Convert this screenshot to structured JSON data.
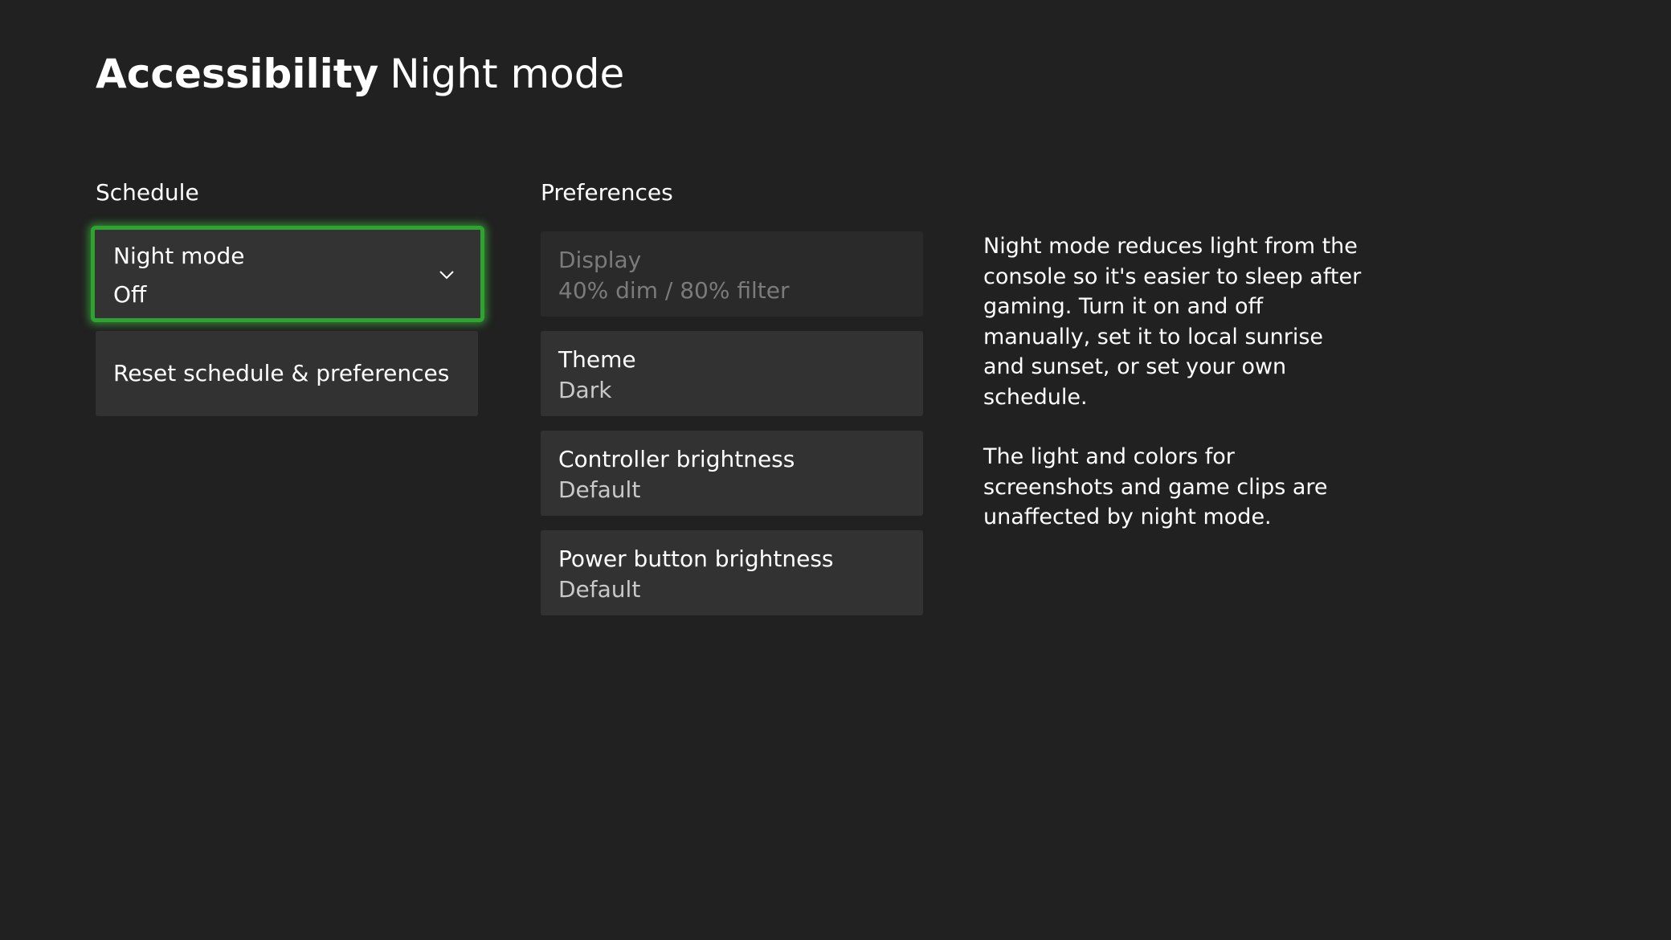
{
  "header": {
    "title_bold": "Accessibility",
    "title_light": "Night mode"
  },
  "schedule": {
    "label": "Schedule",
    "night_mode": {
      "label": "Night mode",
      "value": "Off",
      "icon": "chevron-down-icon"
    },
    "reset_label": "Reset schedule & preferences"
  },
  "preferences": {
    "label": "Preferences",
    "items": [
      {
        "label": "Display",
        "value": "40% dim / 80% filter",
        "disabled": true
      },
      {
        "label": "Theme",
        "value": "Dark",
        "disabled": false
      },
      {
        "label": "Controller brightness",
        "value": "Default",
        "disabled": false
      },
      {
        "label": "Power button brightness",
        "value": "Default",
        "disabled": false
      }
    ]
  },
  "description": {
    "paragraphs": [
      "Night mode reduces light from the console so it's easier to sleep after gaming. Turn it on and off manually, set it to local sunrise and sunset, or set your own schedule.",
      "The light and colors for screenshots and game clips are unaffected by night mode."
    ]
  },
  "colors": {
    "background": "#212121",
    "tile": "#323232",
    "focus_border": "#2fa32f"
  }
}
